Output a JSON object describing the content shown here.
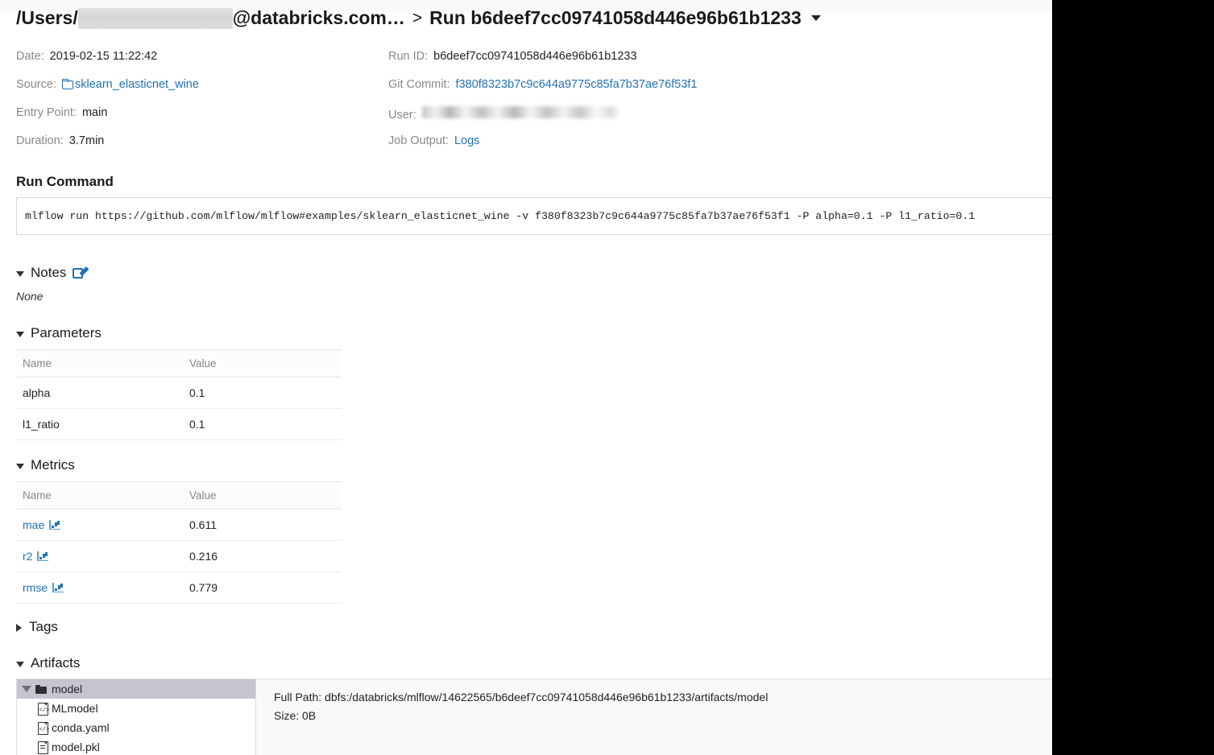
{
  "header": {
    "path_prefix": "/Users/",
    "redacted_user": "",
    "domain_suffix": "@databricks.com…",
    "separator": ">",
    "run_title": "Run b6deef7cc09741058d446e96b61b1233",
    "dropdown_icon": "caret-down-icon"
  },
  "meta": {
    "date_label": "Date:",
    "date_value": "2019-02-15 11:22:42",
    "source_label": "Source:",
    "source_value": "sklearn_elasticnet_wine",
    "source_icon": "folder-icon",
    "entry_point_label": "Entry Point:",
    "entry_point_value": "main",
    "duration_label": "Duration:",
    "duration_value": "3.7min",
    "run_id_label": "Run ID:",
    "run_id_value": "b6deef7cc09741058d446e96b61b1233",
    "git_commit_label": "Git Commit:",
    "git_commit_value": "f380f8323b7c9c644a9775c85fa7b37ae76f53f1",
    "user_label": "User:",
    "user_value": "",
    "job_output_label": "Job Output:",
    "job_output_value": "Logs"
  },
  "run_command": {
    "title": "Run Command",
    "value": "mlflow run https://github.com/mlflow/mlflow#examples/sklearn_elasticnet_wine -v f380f8323b7c9c644a9775c85fa7b37ae76f53f1 -P alpha=0.1 -P l1_ratio=0.1"
  },
  "notes": {
    "label": "Notes",
    "edit_icon": "edit-icon",
    "body": "None"
  },
  "parameters": {
    "label": "Parameters",
    "columns": [
      "Name",
      "Value"
    ],
    "rows": [
      {
        "name": "alpha",
        "value": "0.1"
      },
      {
        "name": "l1_ratio",
        "value": "0.1"
      }
    ]
  },
  "metrics": {
    "label": "Metrics",
    "columns": [
      "Name",
      "Value"
    ],
    "rows": [
      {
        "name": "mae",
        "value": "0.611",
        "icon": "line-chart-icon"
      },
      {
        "name": "r2",
        "value": "0.216",
        "icon": "line-chart-icon"
      },
      {
        "name": "rmse",
        "value": "0.779",
        "icon": "line-chart-icon"
      }
    ]
  },
  "tags": {
    "label": "Tags",
    "expanded": false
  },
  "artifacts": {
    "label": "Artifacts",
    "expanded": true,
    "tree": [
      {
        "name": "model",
        "type": "folder",
        "selected": true,
        "expanded": true
      },
      {
        "name": "MLmodel",
        "type": "code-file",
        "selected": false
      },
      {
        "name": "conda.yaml",
        "type": "code-file",
        "selected": false
      },
      {
        "name": "model.pkl",
        "type": "file",
        "selected": false
      }
    ],
    "full_path_label": "Full Path:",
    "full_path_value": "dbfs:/databricks/mlflow/14622565/b6deef7cc09741058d446e96b61b1233/artifacts/model",
    "size_label": "Size:",
    "size_value": "0B"
  },
  "colors": {
    "link": "#2272b4",
    "text": "#222222",
    "muted": "#888888",
    "selection": "#c6c4d0",
    "panel_bg": "#f9f9f9"
  }
}
